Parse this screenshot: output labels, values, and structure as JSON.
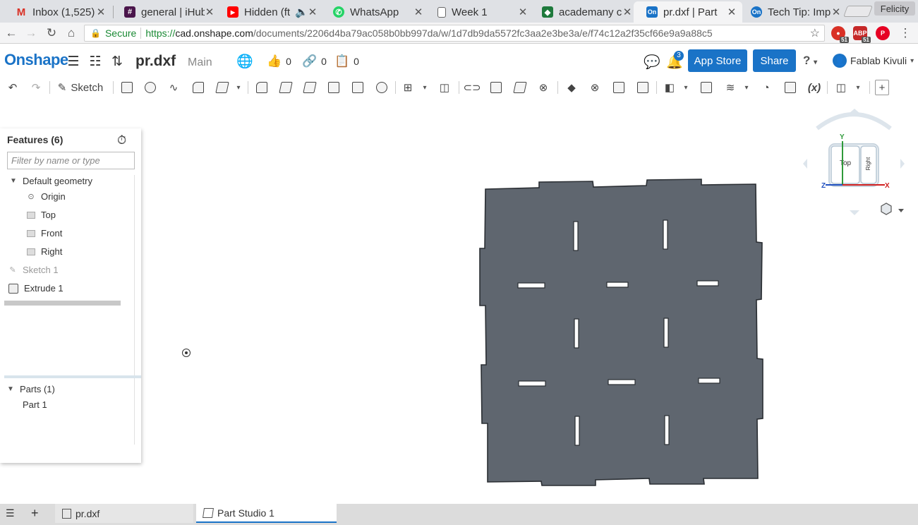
{
  "browser": {
    "tabs": [
      {
        "title": "Inbox (1,525)",
        "favicon": "gmail-icon",
        "color": "#d93025",
        "glyph": "M"
      },
      {
        "title": "general | iHub",
        "favicon": "slack-icon",
        "color": "#4a154b",
        "glyph": "#"
      },
      {
        "title": "Hidden (ft",
        "favicon": "youtube-icon",
        "color": "#ff0000",
        "glyph": "▶"
      },
      {
        "title": "WhatsApp",
        "favicon": "whatsapp-icon",
        "color": "#25d366",
        "glyph": "✆"
      },
      {
        "title": "Week 1",
        "favicon": "document-icon",
        "color": "#ffffff",
        "glyph": "▯"
      },
      {
        "title": "academany c",
        "favicon": "academany-icon",
        "color": "#1e7a3c",
        "glyph": "◆"
      },
      {
        "title": "pr.dxf | Part",
        "favicon": "onshape-icon",
        "color": "#1a73c7",
        "glyph": "On"
      },
      {
        "title": "Tech Tip: Imp",
        "favicon": "onshape-icon",
        "color": "#1a73c7",
        "glyph": "On"
      }
    ],
    "profile_name": "Felicity",
    "address": {
      "secure_label": "Secure",
      "scheme": "https://",
      "host": "cad.onshape.com",
      "path": "/documents/2206d4ba79ac058b0bb997da/w/1d7db9da5572fc3aa2e3be3a/e/f74c12a2f35cf66e9a9a88c5"
    },
    "extensions": [
      {
        "name": "extension-red-icon",
        "badge": "51",
        "color": "#d93025"
      },
      {
        "name": "adblock-icon",
        "badge": "51",
        "color": "#c62828",
        "glyph": "ABP"
      },
      {
        "name": "pinterest-icon",
        "badge": "",
        "color": "#e60023",
        "glyph": "P"
      }
    ]
  },
  "onshape": {
    "logo": "Onshape",
    "document_name": "pr.dxf",
    "branch": "Main",
    "likes": "0",
    "links": "0",
    "copies": "0",
    "notifications": "3",
    "app_store_label": "App Store",
    "share_label": "Share",
    "help_label": "?",
    "user_name": "Fablab Kivuli",
    "sketch_label": "Sketch",
    "fx_label": "(x)"
  },
  "features": {
    "title": "Features (6)",
    "filter_placeholder": "Filter by name or type",
    "default_geometry": "Default geometry",
    "origin": "Origin",
    "top": "Top",
    "front": "Front",
    "right": "Right",
    "sketch1": "Sketch 1",
    "extrude1": "Extrude 1",
    "parts_header": "Parts (1)",
    "part1": "Part 1"
  },
  "viewcube": {
    "face_top": "Top",
    "face_right": "Right",
    "axis_x": "X",
    "axis_y": "Y",
    "axis_z": "Z"
  },
  "bottom_tabs": {
    "tab1": "pr.dxf",
    "tab2": "Part Studio 1"
  },
  "colors": {
    "accent": "#1a73c7",
    "part_fill": "#5f666f",
    "secure_green": "#1a8a34"
  }
}
